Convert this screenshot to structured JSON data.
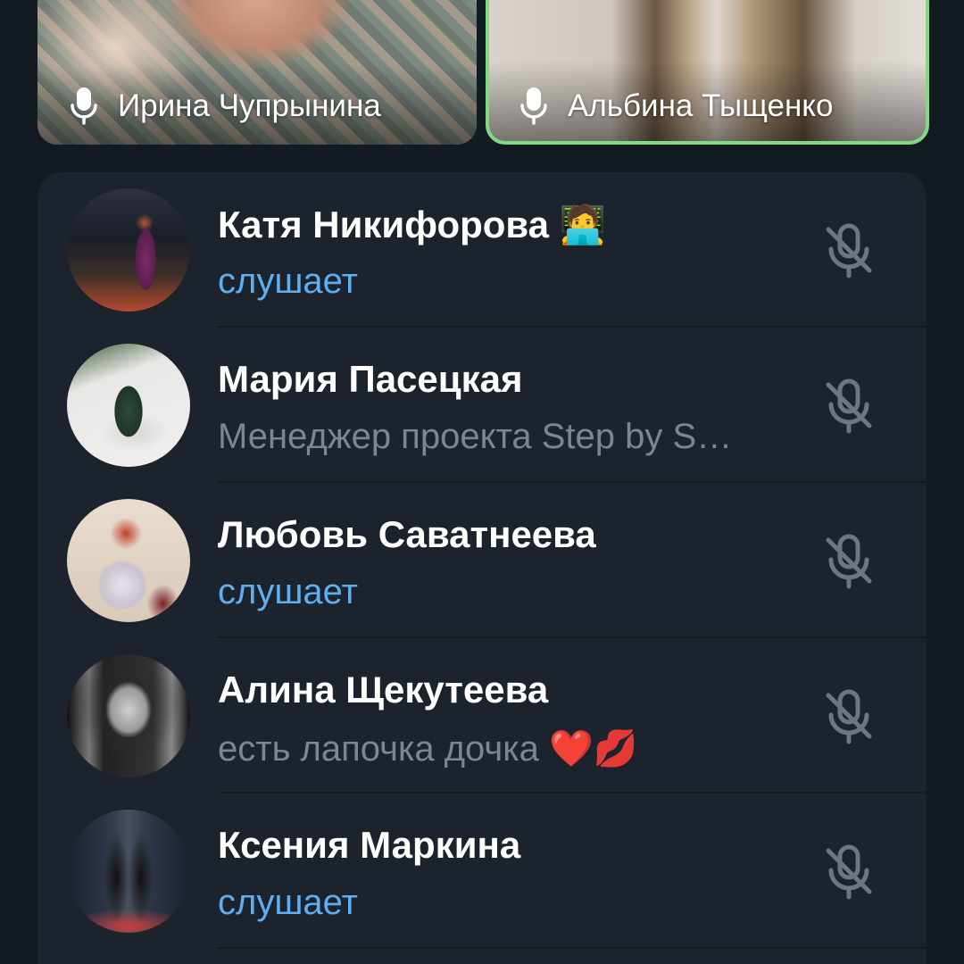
{
  "video_tiles": [
    {
      "name": "Ирина Чупрынина",
      "icon": "mic-icon",
      "active_speaker": false
    },
    {
      "name": "Альбина Тыщенко",
      "icon": "mic-icon",
      "active_speaker": true,
      "highlight_color": "#7ddc83"
    }
  ],
  "participants": [
    {
      "name": "Катя Никифорова",
      "name_emoji": "🧑‍💻",
      "status": "слушает",
      "status_type": "listening",
      "mic": "mic-muted-icon"
    },
    {
      "name": "Мария Пасецкая",
      "name_emoji": "",
      "status": "Менеджер проекта Step by S…",
      "status_type": "bio",
      "mic": "mic-muted-icon"
    },
    {
      "name": "Любовь Саватнеева",
      "name_emoji": "",
      "status": "слушает",
      "status_type": "listening",
      "mic": "mic-muted-icon"
    },
    {
      "name": "Алина Щекутеева",
      "name_emoji": "",
      "status": "есть лапочка дочка ❤️💋",
      "status_type": "bio",
      "mic": "mic-muted-icon"
    },
    {
      "name": "Ксения Маркина",
      "name_emoji": "",
      "status": "слушает",
      "status_type": "listening",
      "mic": "mic-muted-icon"
    }
  ],
  "colors": {
    "background": "#141a22",
    "panel": "#1c232d",
    "listening": "#5eaef0",
    "bio": "#7c8590",
    "muted_icon": "#6c7580"
  }
}
